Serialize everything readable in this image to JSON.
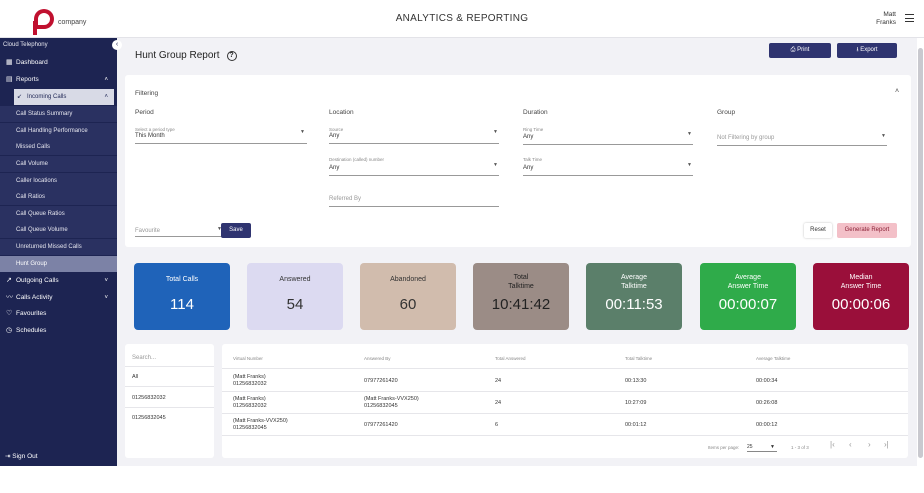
{
  "header": {
    "logo_text": "company",
    "title": "ANALYTICS & REPORTING",
    "user_line1": "Matt",
    "user_line2": "Franks"
  },
  "sidebar": {
    "heading": "Cloud Telephony",
    "collapse_icon": "chevron-left-icon",
    "items": [
      {
        "label": "Dashboard",
        "icon": "dashboard-icon"
      },
      {
        "label": "Reports",
        "icon": "reports-icon"
      },
      {
        "label": "Incoming Calls",
        "icon": "arrow-incoming-icon"
      },
      {
        "label": "Outgoing Calls",
        "icon": "arrow-outgoing-icon"
      },
      {
        "label": "Calls Activity",
        "icon": "activity-icon"
      },
      {
        "label": "Favourites",
        "icon": "heart-icon"
      },
      {
        "label": "Schedules",
        "icon": "clock-icon"
      }
    ],
    "sub_items": [
      "Call Status Summary",
      "Call Handling Performance",
      "Missed Calls",
      "Call Volume",
      "Caller locations",
      "Call Ratios",
      "Call Queue Ratios",
      "Call Queue Volume",
      "Unreturned Missed Calls",
      "Hunt Group"
    ],
    "signout": "Sign Out"
  },
  "page": {
    "title": "Hunt Group Report",
    "print_label": "Print",
    "export_label": "Export"
  },
  "filtering": {
    "title": "Filtering",
    "period": {
      "heading": "Period",
      "label": "Select a period type",
      "value": "This Month"
    },
    "location": {
      "heading": "Location",
      "source_label": "Source",
      "source_value": "Any",
      "dest_label": "Destination (called) number",
      "dest_value": "Any",
      "referred_placeholder": "Referred By"
    },
    "duration": {
      "heading": "Duration",
      "ring_label": "Ring Time",
      "ring_value": "Any",
      "talk_label": "Talk Time",
      "talk_value": "Any"
    },
    "group": {
      "heading": "Group",
      "placeholder": "Not Filtering by group"
    },
    "favourite_placeholder": "Favourite",
    "save_label": "Save",
    "reset_label": "Reset",
    "generate_label": "Generate Report"
  },
  "stats": [
    {
      "title": "Total Calls",
      "value": "114",
      "bg": "#1f63b9",
      "fg": "#ffffff"
    },
    {
      "title": "Answered",
      "value": "54",
      "bg": "#dcdaf1",
      "fg": "#333333"
    },
    {
      "title": "Abandoned",
      "value": "60",
      "bg": "#d1bcad",
      "fg": "#333333"
    },
    {
      "title": "Total\nTalktime",
      "value": "10:41:42",
      "bg": "#9b8c86",
      "fg": "#222222"
    },
    {
      "title": "Average\nTalktime",
      "value": "00:11:53",
      "bg": "#5b7f6a",
      "fg": "#ffffff"
    },
    {
      "title": "Average\nAnswer Time",
      "value": "00:00:07",
      "bg": "#2fab4a",
      "fg": "#ffffff"
    },
    {
      "title": "Median\nAnswer Time",
      "value": "00:00:06",
      "bg": "#9a0f3a",
      "fg": "#ffffff"
    }
  ],
  "search": {
    "placeholder": "Search...",
    "items": [
      "All",
      "01256832032",
      "01256832045"
    ]
  },
  "table": {
    "columns": [
      "Virtual Number",
      "Answered By",
      "Total Answered",
      "Total Talktime",
      "Average Talktime"
    ],
    "rows": [
      {
        "virtual": "(Matt Franks)",
        "virtual2": "01256832032",
        "answered": "07977261420",
        "answered2": "",
        "total": "24",
        "talk": "00:13:30",
        "avg": "00:00:34"
      },
      {
        "virtual": "(Matt Franks)",
        "virtual2": "01256832032",
        "answered": "(Matt Franks-VVX250)",
        "answered2": "01256832045",
        "total": "24",
        "talk": "10:27:09",
        "avg": "00:26:08"
      },
      {
        "virtual": "(Matt Franks-VVX250)",
        "virtual2": "01256832045",
        "answered": "07977261420",
        "answered2": "",
        "total": "6",
        "talk": "00:01:12",
        "avg": "00:00:12"
      }
    ],
    "pagination": {
      "items_per_page_label": "Items per page:",
      "page_size": "25",
      "range": "1 - 3 of 3"
    }
  }
}
